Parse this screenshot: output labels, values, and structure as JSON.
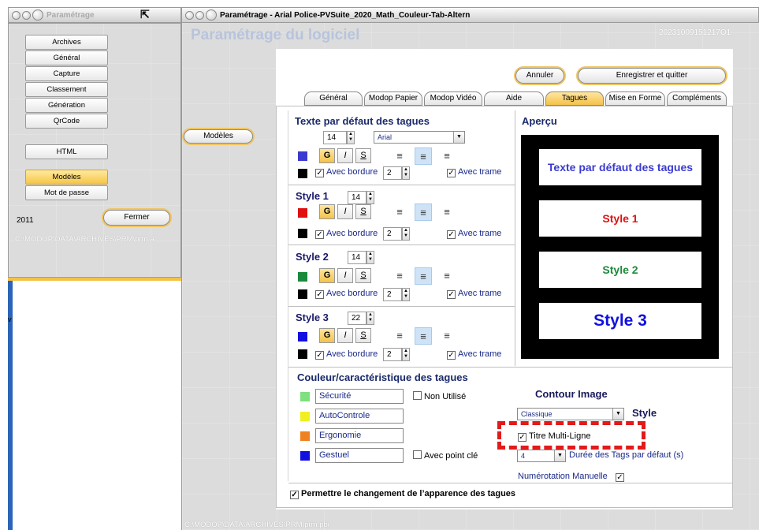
{
  "left_window": {
    "title": "Paramétrage",
    "nav": [
      "Archives",
      "Général",
      "Capture",
      "Classement",
      "Génération",
      "QrCode",
      "HTML",
      "Modèles",
      "Mot de passe"
    ],
    "year": "2011",
    "close_label": "Fermer",
    "path": "C:\\MODOP\\DATA\\ARCHIVES\\PRM\\prm.a"
  },
  "main_window": {
    "title": "Paramétrage - Arial Police-PVSuite_2020_Math_Couleur-Tab-Altern",
    "heading": "Paramétrage du logiciel",
    "timestamp": "20231009151217O1",
    "side_button": "Modèles",
    "cancel_label": "Annuler",
    "save_label": "Enregistrer et quitter",
    "tabs": [
      "Général",
      "Modop Papier",
      "Modop Vidéo",
      "Aide",
      "Tagues",
      "Mise en Forme",
      "Compléments"
    ],
    "footer_path": "C:\\MODOP\\DATA\\ARCHIVES\\PRM\\prm.pbi"
  },
  "texte": {
    "title": "Texte par défaut des tagues",
    "size": "14",
    "font": "Arial",
    "border_label": "Avec bordure",
    "border_size": "2",
    "trame_label": "Avec trame"
  },
  "styles": [
    {
      "title": "Style 1",
      "size": "14",
      "border_size": "2"
    },
    {
      "title": "Style 2",
      "size": "14",
      "border_size": "2"
    },
    {
      "title": "Style 3",
      "size": "22",
      "border_size": "2"
    }
  ],
  "format": {
    "bold": "G",
    "italic": "I",
    "underline": "S",
    "align_left": "≡",
    "align_center": "≡",
    "align_right": "≡"
  },
  "preview": {
    "title": "Aperçu",
    "texte": "Texte par défaut des tagues",
    "s1": "Style 1",
    "s2": "Style 2",
    "s3": "Style 3",
    "colors": {
      "texte": "#3a3ad0",
      "s1": "#e01010",
      "s2": "#1a8a3a",
      "s3": "#1010e0"
    }
  },
  "couleur": {
    "title": "Couleur/caractéristique des tagues",
    "tags": [
      {
        "label": "Sécurité",
        "color": "#7ee07e"
      },
      {
        "label": "AutoControle",
        "color": "#f0f020"
      },
      {
        "label": "Ergonomie",
        "color": "#f08020"
      },
      {
        "label": "Gestuel",
        "color": "#1010e0"
      }
    ],
    "non_utilise": "Non Utilisé",
    "point_cle": "Avec point clé"
  },
  "contour": {
    "title": "Contour Image",
    "style_value": "Classique",
    "style_label": "Style",
    "multiline_label": "Titre Multi-Ligne",
    "duree_value": "4",
    "duree_label": "Durée des Tags par défaut (s)",
    "num_label": "Numérotation Manuelle"
  },
  "permettre_label": "Permettre le changement de l’apparence des tagues"
}
